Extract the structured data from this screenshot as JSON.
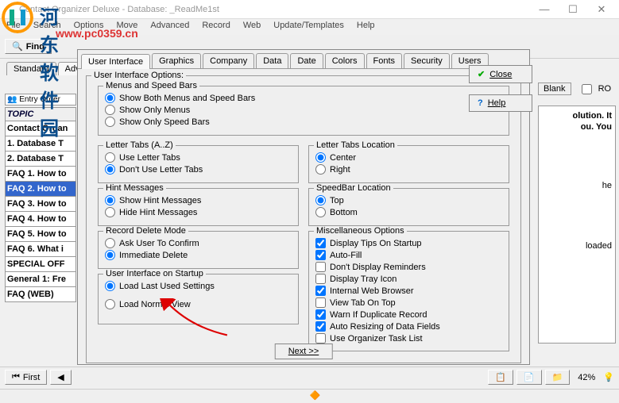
{
  "window": {
    "title": "Contact Organizer Deluxe - Database: _ReadMe1st"
  },
  "menu": [
    "File",
    "Search",
    "Options",
    "Move",
    "Advanced",
    "Record",
    "Web",
    "Update/Templates",
    "Help"
  ],
  "watermark": {
    "text": "河东软件园",
    "url": "www.pc0359.cn"
  },
  "toolbar": {
    "find": "Find"
  },
  "outer_tabs": {
    "standard": "Standard",
    "advanced": "Advan"
  },
  "left": {
    "entry_order": "Entry Order",
    "topic_header": "TOPIC",
    "rows": [
      "Contact Organ",
      "1. Database T",
      "2. Database T",
      "FAQ 1. How to",
      "FAQ 2. How to",
      "FAQ 3. How to",
      "FAQ 4. How to",
      "FAQ 5. How to",
      "FAQ 6. What i",
      "SPECIAL OFF",
      "General 1: Fre",
      "FAQ (WEB)"
    ],
    "selected_index": 4
  },
  "dialog": {
    "tabs": [
      "User Interface",
      "Graphics",
      "Company",
      "Data",
      "Date",
      "Colors",
      "Fonts",
      "Security",
      "Users"
    ],
    "active_tab": 0,
    "group_label": "User Interface Options:",
    "menus_speed": {
      "legend": "Menus and Speed Bars",
      "opts": [
        "Show Both Menus and Speed Bars",
        "Show Only Menus",
        "Show Only Speed Bars"
      ],
      "selected": 0
    },
    "letter_tabs": {
      "legend": "Letter Tabs (A..Z)",
      "opts": [
        "Use Letter Tabs",
        "Don't Use Letter Tabs"
      ],
      "selected": 1
    },
    "letter_loc": {
      "legend": "Letter Tabs Location",
      "opts": [
        "Center",
        "Right"
      ],
      "selected": 0
    },
    "hint": {
      "legend": "Hint Messages",
      "opts": [
        "Show Hint Messages",
        "Hide Hint Messages"
      ],
      "selected": 0
    },
    "speedbar_loc": {
      "legend": "SpeedBar Location",
      "opts": [
        "Top",
        "Bottom"
      ],
      "selected": 0
    },
    "delete_mode": {
      "legend": "Record Delete Mode",
      "opts": [
        "Ask User To Confirm",
        "Immediate Delete"
      ],
      "selected": 1
    },
    "misc": {
      "legend": "Miscellaneous Options",
      "items": [
        {
          "label": "Display Tips On Startup",
          "checked": true
        },
        {
          "label": "Auto-Fill",
          "checked": true
        },
        {
          "label": "Don't Display Reminders",
          "checked": false
        },
        {
          "label": "Display Tray Icon",
          "checked": false
        },
        {
          "label": "Internal Web Browser",
          "checked": true
        },
        {
          "label": "View Tab On Top",
          "checked": false
        },
        {
          "label": "Warn If Duplicate Record",
          "checked": true
        },
        {
          "label": "Auto Resizing of Data Fields",
          "checked": true
        },
        {
          "label": "Use Organizer Task List",
          "checked": false
        }
      ]
    },
    "startup": {
      "legend": "User Interface on Startup",
      "opts": [
        "Load Last Used Settings",
        "Load Normal View"
      ],
      "selected": 0
    },
    "buttons": {
      "close": "Close",
      "help": "Help",
      "next": "Next >>"
    }
  },
  "right": {
    "blank": "Blank",
    "ro": "RO",
    "frag1": "olution. It",
    "frag2": "ou. You",
    "frag3": "he",
    "frag4": "loaded"
  },
  "bottom": {
    "first": "First",
    "pct": "42%"
  }
}
